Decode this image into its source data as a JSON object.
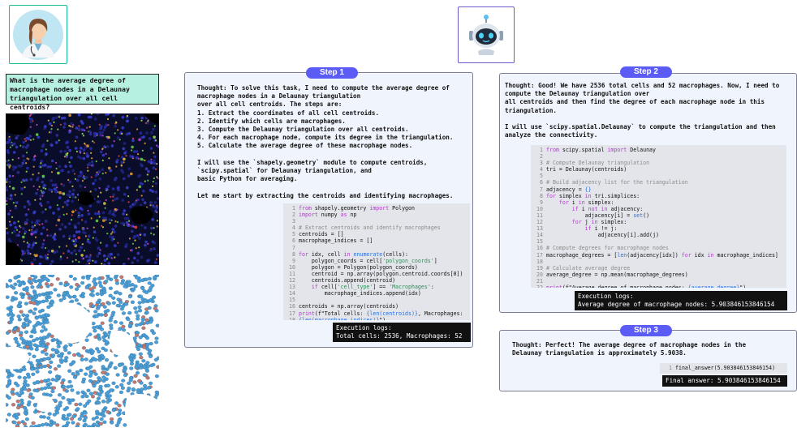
{
  "question": "What is the average degree of macrophage nodes in a Delaunay triangulation over all cell centroids?",
  "steps": [
    {
      "label": "Step 1",
      "thought": "Thought: To solve this task, I need to compute the average degree of\nmacrophage nodes in a Delaunay triangulation\nover all cell centroids. The steps are:\n1. Extract the coordinates of all cell centroids.\n2. Identify which cells are macrophages.\n3. Compute the Delaunay triangulation over all centroids.\n4. For each macrophage node, compute its degree in the triangulation.\n5. Calculate the average degree of these macrophage nodes.\n\nI will use the `shapely.geometry` module to compute centroids,\n`scipy.spatial` for Delaunay triangulation, and\nbasic Python for averaging.\n\nLet me start by extracting the centroids and identifying macrophages.",
      "code": [
        "from shapely.geometry import Polygon",
        "import numpy as np",
        "",
        "# Extract centroids and identify macrophages",
        "centroids = []",
        "macrophage_indices = []",
        "",
        "for idx, cell in enumerate(cells):",
        "    polygon_coords = cell['polygon_coords']",
        "    polygon = Polygon(polygon_coords)",
        "    centroid = np.array(polygon.centroid.coords[0])",
        "    centroids.append(centroid)",
        "    if cell['cell_type'] == 'Macrophages':",
        "        macrophage_indices.append(idx)",
        "",
        "centroids = np.array(centroids)",
        "print(f\"Total cells: {len(centroids)}, Macrophages:",
        "{len(macrophage_indices)}\")"
      ],
      "log_title": "Execution logs:",
      "log_text": "Total cells: 2536, Macrophages: 52"
    },
    {
      "label": "Step 2",
      "thought": "Thought: Good! We have 2536 total cells and 52 macrophages. Now, I need to\ncompute the Delaunay triangulation over\nall centroids and then find the degree of each macrophage node in this\ntriangulation.\n\nI will use `scipy.spatial.Delaunay` to compute the triangulation and then\nanalyze the connectivity.",
      "code": [
        "from scipy.spatial import Delaunay",
        "",
        "# Compute Delaunay triangulation",
        "tri = Delaunay(centroids)",
        "",
        "# Build adjacency list for the triangulation",
        "adjacency = {}",
        "for simplex in tri.simplices:",
        "    for i in simplex:",
        "        if i not in adjacency:",
        "            adjacency[i] = set()",
        "        for j in simplex:",
        "            if i != j:",
        "                adjacency[i].add(j)",
        "",
        "# Compute degrees for macrophage nodes",
        "macrophage_degrees = [len(adjacency[idx]) for idx in macrophage_indices]",
        "",
        "# Calculate average degree",
        "average_degree = np.mean(macrophage_degrees)",
        "",
        "print(f\"Average degree of macrophage nodes: {average_degree}\")"
      ],
      "log_title": "Execution logs:",
      "log_text": "Average degree of macrophage nodes: 5.903846153846154"
    },
    {
      "label": "Step 3",
      "thought": "Thought: Perfect! The average degree of macrophage nodes in the\nDelaunay triangulation is approximately 5.9038.",
      "code": [
        "final_answer(5.903846153846154)"
      ],
      "log_text": "Final answer: 5.903846153846154"
    }
  ],
  "colors": {
    "badge": "#5b5bf6",
    "question_bg": "#b6f0e1",
    "panel_bg": "#f0f4fc",
    "code_bg": "#e3e5ea",
    "cell_blue": "#4a9fd8",
    "cell_red": "#c8776b"
  },
  "icons": [
    "doctor-avatar-icon",
    "robot-avatar-icon"
  ]
}
